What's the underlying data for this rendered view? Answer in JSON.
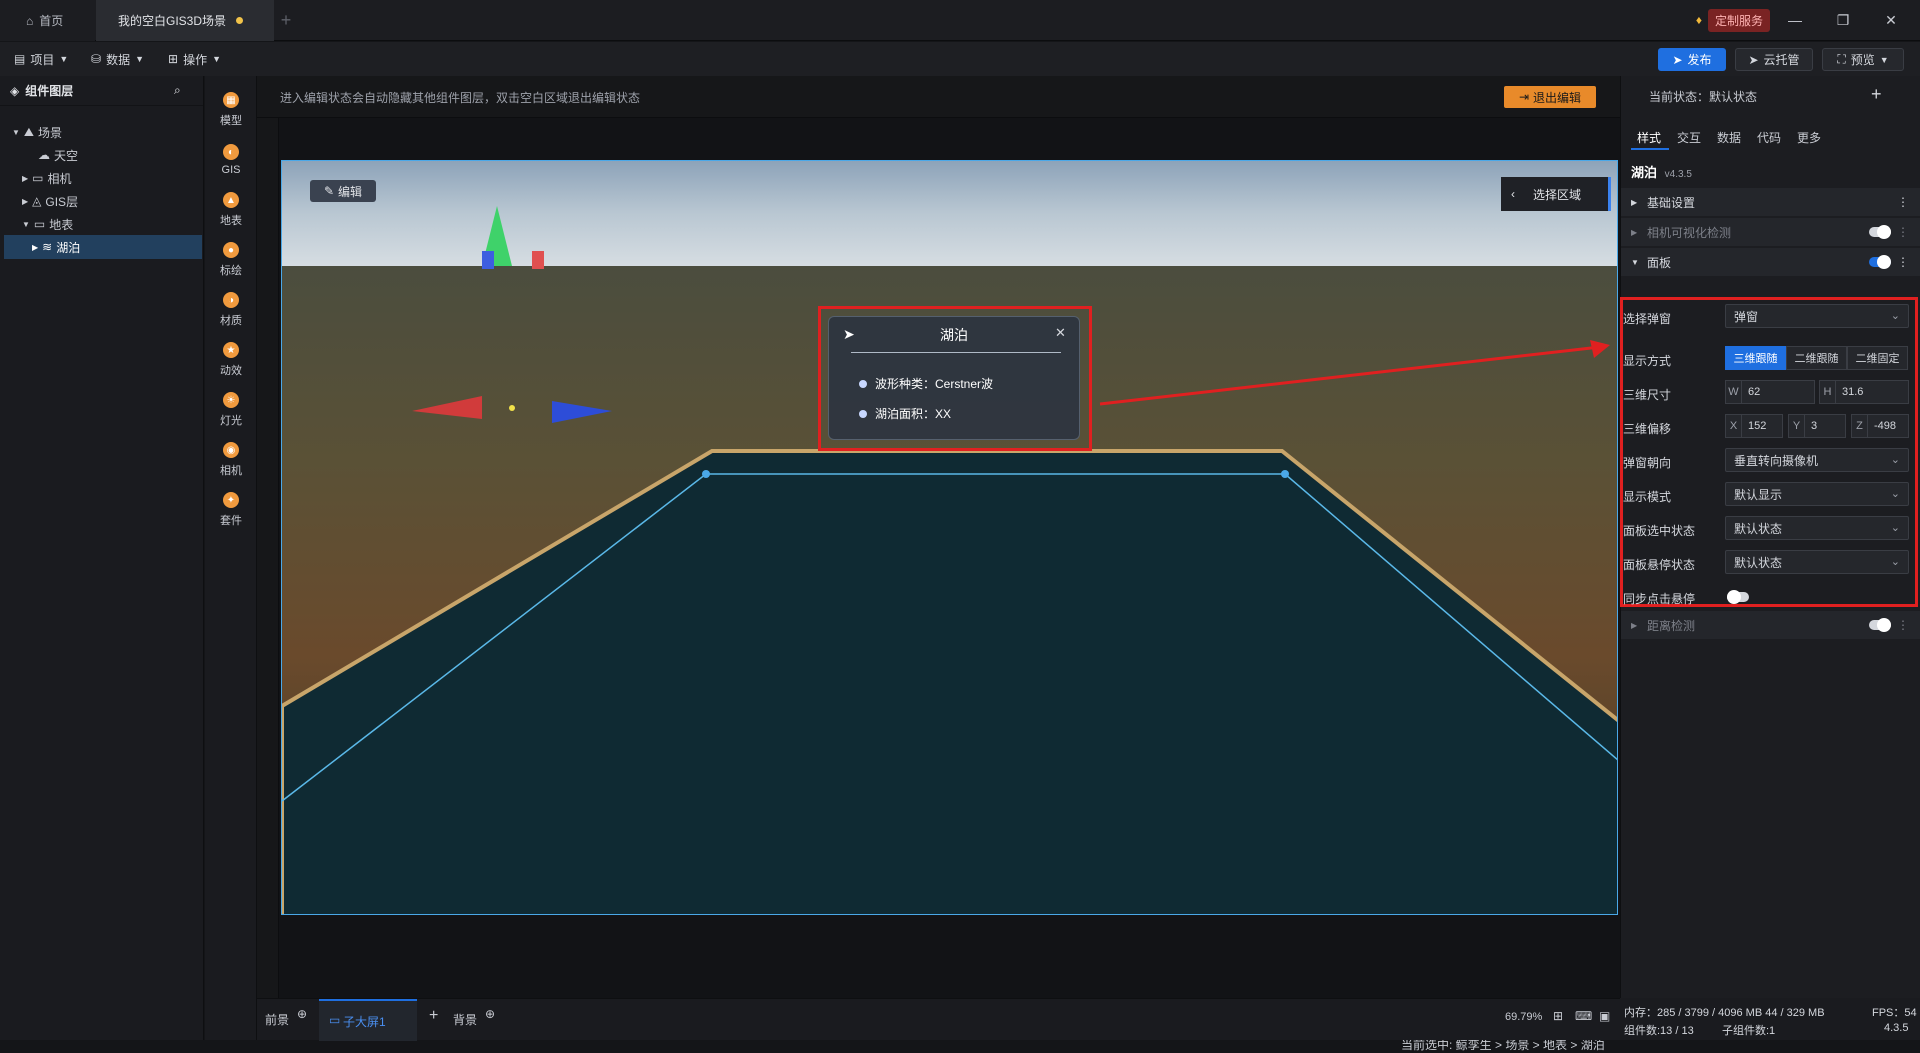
{
  "titlebar": {
    "tab_home": "首页",
    "tab_scene": "我的空白GIS3D场景",
    "tab_add": "+",
    "custom_service": "定制服务"
  },
  "menubar": {
    "project": "项目",
    "data": "数据",
    "operation": "操作",
    "publish": "发布",
    "cloud_host": "云托管",
    "preview": "预览"
  },
  "left_panel": {
    "title": "组件图层",
    "tree": [
      {
        "label": "场景"
      },
      {
        "label": "天空"
      },
      {
        "label": "相机"
      },
      {
        "label": "GIS层"
      },
      {
        "label": "地表"
      },
      {
        "label": "湖泊"
      }
    ]
  },
  "tools": [
    "模型",
    "GIS",
    "地表",
    "标绘",
    "材质",
    "动效",
    "灯光",
    "相机",
    "套件"
  ],
  "canvas": {
    "hint": "进入编辑状态会自动隐藏其他组件图层，双击空白区域退出编辑状态",
    "exit_edit": "退出编辑",
    "edit_button": "编辑",
    "select_region": "选择区域",
    "popup": {
      "title": "湖泊",
      "row1": "波形种类：Cerstner波",
      "row2": "湖泊面积：XX"
    },
    "breadcrumb": "当前选中: 鲸孪生 > 场景 > 地表 > 湖泊"
  },
  "right_panel": {
    "state": "当前状态：默认状态",
    "tabs": [
      "样式",
      "交互",
      "数据",
      "代码",
      "更多"
    ],
    "component_title": "湖泊",
    "component_version": "v4.3.5",
    "sections": {
      "basic": "基础设置",
      "camera_visibility": "相机可视化检测",
      "panel": "面板",
      "distance": "距离检测"
    },
    "form": {
      "select_popup_label": "选择弹窗",
      "select_popup_value": "弹窗",
      "display_mode_label": "显示方式",
      "display_mode_options": [
        "三维跟随",
        "二维跟随",
        "二维固定"
      ],
      "size3d_label": "三维尺寸",
      "size_w": "62",
      "size_h": "31.6",
      "offset3d_label": "三维偏移",
      "offset_x": "152",
      "offset_y": "3",
      "offset_z": "-498",
      "orientation_label": "弹窗朝向",
      "orientation_value": "垂直转向摄像机",
      "show_mode_label": "显示模式",
      "show_mode_value": "默认显示",
      "selected_state_label": "面板选中状态",
      "selected_state_value": "默认状态",
      "hover_state_label": "面板悬停状态",
      "hover_state_value": "默认状态",
      "sync_click_label": "同步点击悬停"
    }
  },
  "bottom": {
    "front": "前景",
    "sub_screen": "子大屏1",
    "back": "背景",
    "zoom": "69.79%",
    "memory": "内存：285 / 3799 / 4096 MB  44 / 329 MB",
    "fps": "FPS：54",
    "component_count": "组件数:13 / 13",
    "sub_component_count": "子组件数:1",
    "version": "4.3.5"
  },
  "colors": {
    "accent": "#1f6fe0",
    "highlight_red": "#e02020",
    "exit_orange": "#e88a2a"
  }
}
